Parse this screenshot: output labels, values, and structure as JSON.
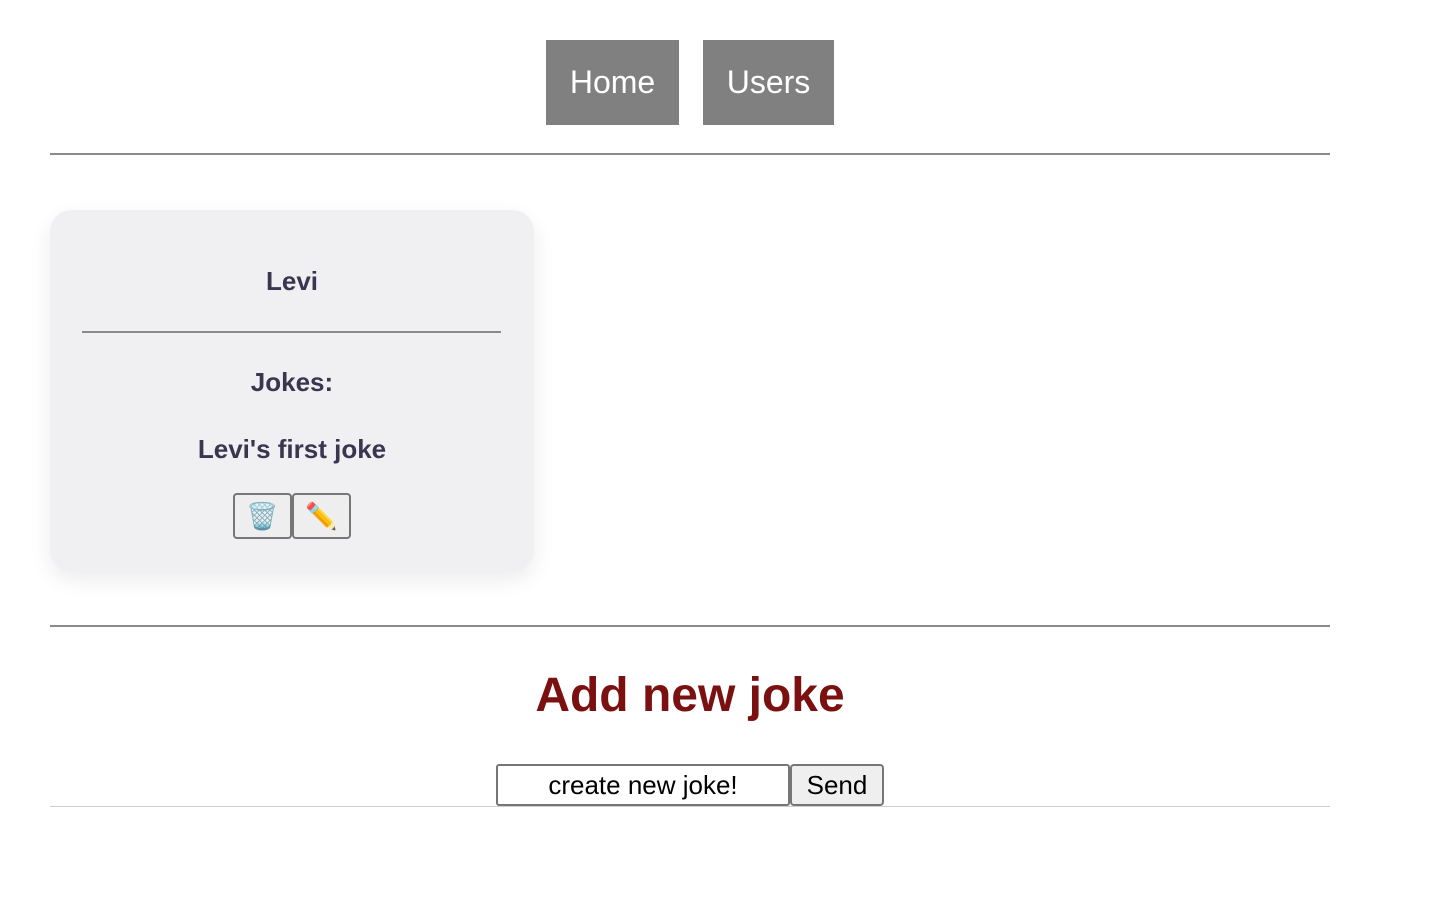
{
  "nav": {
    "items": [
      {
        "label": "Home"
      },
      {
        "label": "Users"
      }
    ]
  },
  "user_card": {
    "name": "Levi",
    "jokes_label": "Jokes:",
    "jokes": [
      {
        "text": "Levi's first joke",
        "delete_icon": "trash-can-icon",
        "edit_icon": "pencil-icon"
      }
    ]
  },
  "add_joke": {
    "title": "Add new joke",
    "input_placeholder": "create new joke!",
    "input_value": "",
    "send_label": "Send"
  },
  "colors": {
    "nav_button_bg": "#808080",
    "card_bg": "#f0f0f2",
    "card_text": "#3a3650",
    "title_accent": "#7a1010"
  }
}
